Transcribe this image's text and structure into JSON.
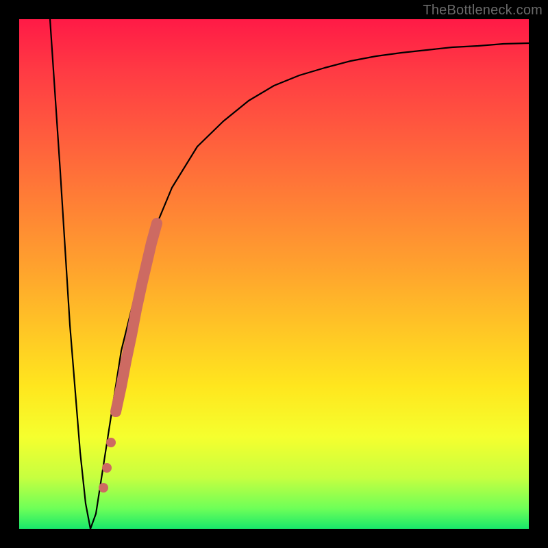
{
  "watermark": "TheBottleneck.com",
  "chart_data": {
    "type": "line",
    "title": "",
    "xlabel": "",
    "ylabel": "",
    "xlim": [
      0,
      100
    ],
    "ylim": [
      0,
      100
    ],
    "series": [
      {
        "name": "main-curve",
        "x": [
          6,
          8,
          10,
          12,
          13,
          14,
          15,
          17,
          20,
          25,
          30,
          35,
          40,
          45,
          50,
          55,
          60,
          65,
          70,
          75,
          80,
          85,
          90,
          95,
          100
        ],
        "y": [
          100,
          70,
          40,
          15,
          5,
          0,
          3,
          15,
          35,
          55,
          67,
          75,
          80,
          84,
          87,
          89,
          90.5,
          91.8,
          92.7,
          93.4,
          94,
          94.5,
          94.8,
          95.1,
          95.3
        ]
      }
    ],
    "highlights": [
      {
        "name": "highlight-segment",
        "color": "#cd6a62",
        "x": [
          19,
          20,
          21,
          22,
          23,
          24,
          25,
          26,
          27
        ],
        "y": [
          23,
          28,
          33,
          38,
          43,
          48,
          52,
          56,
          60
        ]
      },
      {
        "name": "highlight-dots",
        "color": "#cd6a62",
        "points": [
          {
            "x": 16.5,
            "y": 8
          },
          {
            "x": 17.2,
            "y": 12
          },
          {
            "x": 18.0,
            "y": 17
          }
        ]
      }
    ],
    "background_gradient": {
      "top": "#ff1a46",
      "bottom": "#18e86a"
    }
  }
}
